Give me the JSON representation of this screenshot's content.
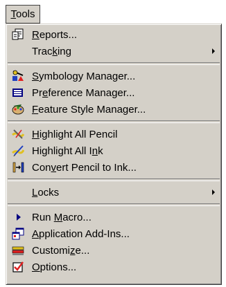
{
  "menubar": {
    "title_pre": "",
    "title_acc": "T",
    "title_post": "ools"
  },
  "menu": {
    "reports": {
      "pre": "",
      "acc": "R",
      "post": "eports..."
    },
    "tracking": {
      "pre": "Trac",
      "acc": "k",
      "post": "ing"
    },
    "symbology": {
      "pre": "",
      "acc": "S",
      "post": "ymbology Manager..."
    },
    "preference": {
      "pre": "Pr",
      "acc": "e",
      "post": "ference Manager..."
    },
    "feature_style": {
      "pre": "",
      "acc": "F",
      "post": "eature Style Manager..."
    },
    "highlight_pencil": {
      "pre": "",
      "acc": "H",
      "post": "ighlight All Pencil"
    },
    "highlight_ink": {
      "pre": "Highlight All I",
      "acc": "n",
      "post": "k"
    },
    "convert": {
      "pre": "Con",
      "acc": "v",
      "post": "ert Pencil to Ink..."
    },
    "locks": {
      "pre": "",
      "acc": "L",
      "post": "ocks"
    },
    "run_macro": {
      "pre": "Run ",
      "acc": "M",
      "post": "acro..."
    },
    "addins": {
      "pre": "",
      "acc": "A",
      "post": "pplication Add-Ins..."
    },
    "customize": {
      "pre": "Customi",
      "acc": "z",
      "post": "e..."
    },
    "options": {
      "pre": "",
      "acc": "O",
      "post": "ptions..."
    }
  },
  "icons": {
    "reports": "reports-icon",
    "symbology": "symbology-icon",
    "preference": "preference-icon",
    "feature_style": "feature-style-icon",
    "highlight_pencil": "pencil-highlight-icon",
    "highlight_ink": "ink-highlight-icon",
    "convert": "convert-icon",
    "run_macro": "play-icon",
    "addins": "addins-icon",
    "customize": "customize-icon",
    "options": "checkbox-icon"
  }
}
